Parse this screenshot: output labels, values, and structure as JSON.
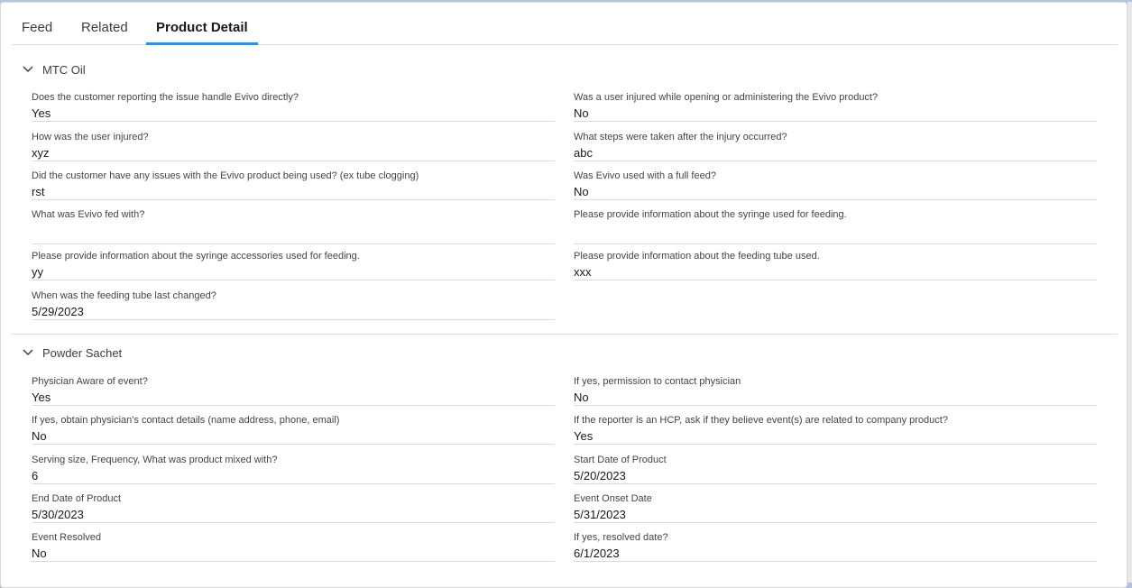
{
  "tabs": [
    {
      "label": "Feed"
    },
    {
      "label": "Related"
    },
    {
      "label": "Product Detail"
    }
  ],
  "sections": [
    {
      "title": "MTC Oil",
      "fields": [
        {
          "label": "Does the customer reporting the issue handle Evivo directly?",
          "value": "Yes"
        },
        {
          "label": "Was a user injured while opening or administering the Evivo product?",
          "value": "No"
        },
        {
          "label": "How was the user injured?",
          "value": "xyz"
        },
        {
          "label": "What steps were taken after the injury occurred?",
          "value": "abc"
        },
        {
          "label": "Did the customer have any issues with the Evivo product being used? (ex tube clogging)",
          "value": "rst"
        },
        {
          "label": "Was Evivo used with a full feed?",
          "value": "No"
        },
        {
          "label": "What was Evivo fed with?",
          "value": ""
        },
        {
          "label": "Please provide information about the syringe used for feeding.",
          "value": ""
        },
        {
          "label": "Please provide information about the syringe accessories used for feeding.",
          "value": "yy"
        },
        {
          "label": "Please provide information about the feeding tube used.",
          "value": "xxx"
        },
        {
          "label": "When was the feeding tube last changed?",
          "value": "5/29/2023"
        }
      ]
    },
    {
      "title": "Powder Sachet",
      "fields": [
        {
          "label": "Physician Aware of event?",
          "value": "Yes"
        },
        {
          "label": "If yes, permission to contact physician",
          "value": "No"
        },
        {
          "label": "If yes, obtain physician's contact details (name address, phone, email)",
          "value": "No"
        },
        {
          "label": "If the reporter is an HCP, ask if they believe event(s) are related to company product?",
          "value": "Yes"
        },
        {
          "label": "Serving size, Frequency, What was product mixed with?",
          "value": "6"
        },
        {
          "label": "Start Date of Product",
          "value": "5/20/2023"
        },
        {
          "label": "End Date of Product",
          "value": "5/30/2023"
        },
        {
          "label": "Event Onset Date",
          "value": "5/31/2023"
        },
        {
          "label": "Event Resolved",
          "value": "No"
        },
        {
          "label": "If yes, resolved date?",
          "value": "6/1/2023"
        }
      ]
    }
  ],
  "colors": {
    "accent": "#1b96ff",
    "border": "#dddbda"
  },
  "icons": {
    "section_toggle": "chevron-down-icon"
  }
}
